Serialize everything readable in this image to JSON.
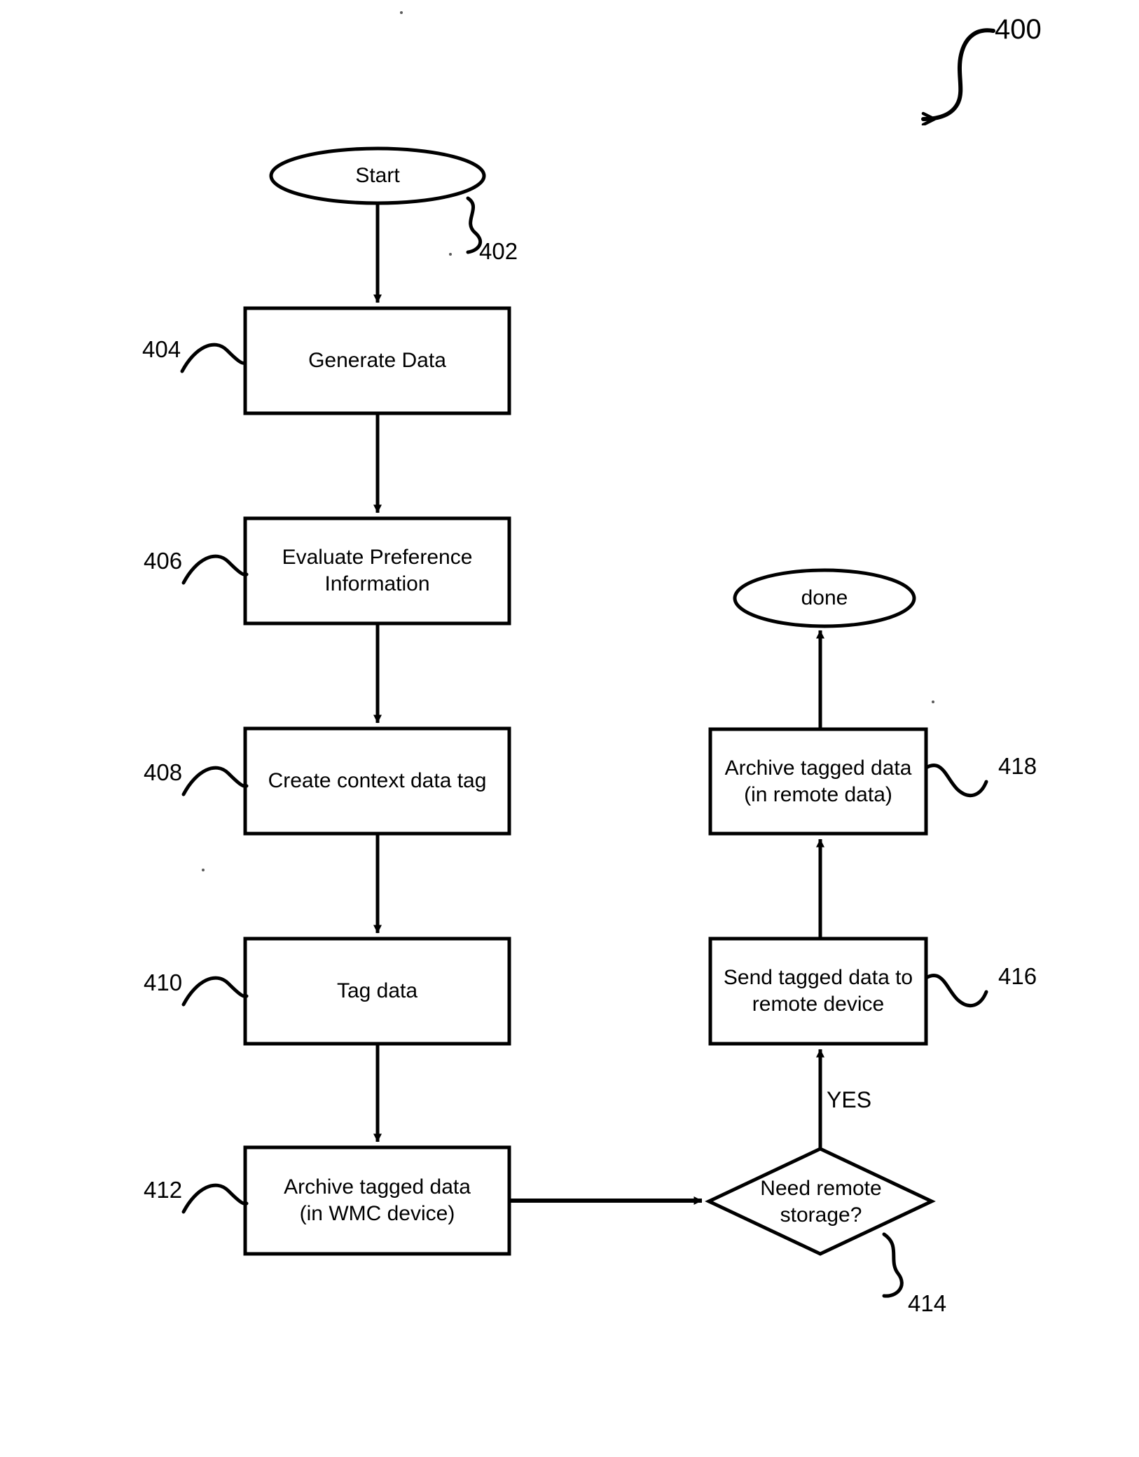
{
  "figure": {
    "number_label": "400",
    "type": "flowchart"
  },
  "nodes": {
    "start": {
      "label": "Start",
      "shape": "ellipse",
      "ref": "402"
    },
    "generate_data": {
      "label": "Generate Data",
      "shape": "rect",
      "ref": "404"
    },
    "evaluate_preference": {
      "label": "Evaluate Preference\nInformation",
      "shape": "rect",
      "ref": "406"
    },
    "create_tag": {
      "label": "Create context data tag",
      "shape": "rect",
      "ref": "408"
    },
    "tag_data": {
      "label": "Tag data",
      "shape": "rect",
      "ref": "410"
    },
    "archive_local": {
      "label": "Archive tagged data\n(in WMC device)",
      "shape": "rect",
      "ref": "412"
    },
    "need_remote": {
      "label": "Need remote\nstorage?",
      "shape": "diamond",
      "ref": "414"
    },
    "send_remote": {
      "label": "Send tagged data to\nremote device",
      "shape": "rect",
      "ref": "416"
    },
    "archive_remote": {
      "label": "Archive tagged data\n(in remote data)",
      "shape": "rect",
      "ref": "418"
    },
    "done": {
      "label": "done",
      "shape": "ellipse",
      "ref": ""
    }
  },
  "edges": [
    {
      "from": "start",
      "to": "generate_data",
      "label": ""
    },
    {
      "from": "generate_data",
      "to": "evaluate_preference",
      "label": ""
    },
    {
      "from": "evaluate_preference",
      "to": "create_tag",
      "label": ""
    },
    {
      "from": "create_tag",
      "to": "tag_data",
      "label": ""
    },
    {
      "from": "tag_data",
      "to": "archive_local",
      "label": ""
    },
    {
      "from": "archive_local",
      "to": "need_remote",
      "label": ""
    },
    {
      "from": "need_remote",
      "to": "send_remote",
      "label": "YES"
    },
    {
      "from": "send_remote",
      "to": "archive_remote",
      "label": ""
    },
    {
      "from": "archive_remote",
      "to": "done",
      "label": ""
    }
  ],
  "edge_labels": {
    "yes": "YES"
  },
  "colors": {
    "stroke": "#000000",
    "fill": "#ffffff",
    "text": "#000000"
  }
}
